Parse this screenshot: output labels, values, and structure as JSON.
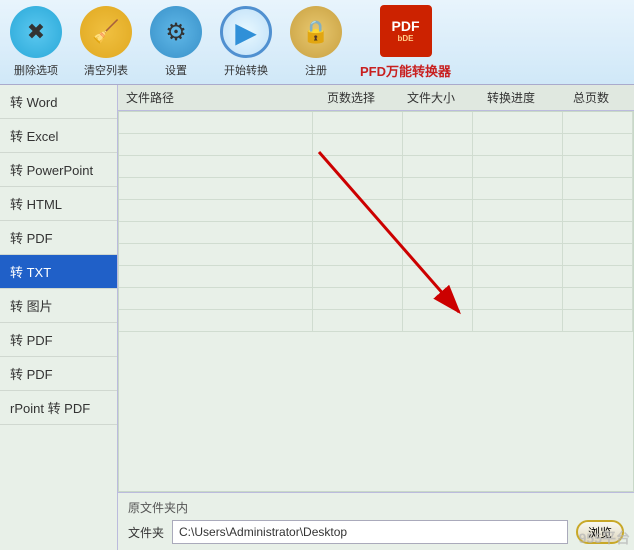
{
  "toolbar": {
    "delete_label": "删除选项",
    "clear_label": "清空列表",
    "settings_label": "设置",
    "start_label": "开始转换",
    "register_label": "注册",
    "app_name": "PFD万能转换器"
  },
  "sidebar": {
    "items": [
      {
        "id": "word",
        "label": "转 Word",
        "active": false
      },
      {
        "id": "excel",
        "label": "转 Excel",
        "active": false
      },
      {
        "id": "ppt",
        "label": "转 PowerPoint",
        "active": false
      },
      {
        "id": "html",
        "label": "转 HTML",
        "active": false
      },
      {
        "id": "pdf1",
        "label": "转 PDF",
        "active": false
      },
      {
        "id": "txt",
        "label": "转 TXT",
        "active": true
      },
      {
        "id": "img",
        "label": "转 图片",
        "active": false
      },
      {
        "id": "pdf2",
        "label": "转 PDF",
        "active": false
      },
      {
        "id": "pdf3",
        "label": "转 PDF",
        "active": false
      },
      {
        "id": "ppt2",
        "label": "rPoint 转 PDF",
        "active": false
      }
    ]
  },
  "table": {
    "headers": [
      "文件路径",
      "页数选择",
      "文件大小",
      "转换进度",
      "总页数"
    ],
    "rows": 10
  },
  "bottom": {
    "section_label": "原文件夹内",
    "folder_label": "文件夹",
    "folder_value": "C:\\Users\\Administrator\\Desktop",
    "browse_label": "浏览"
  },
  "watermark": "955平台"
}
